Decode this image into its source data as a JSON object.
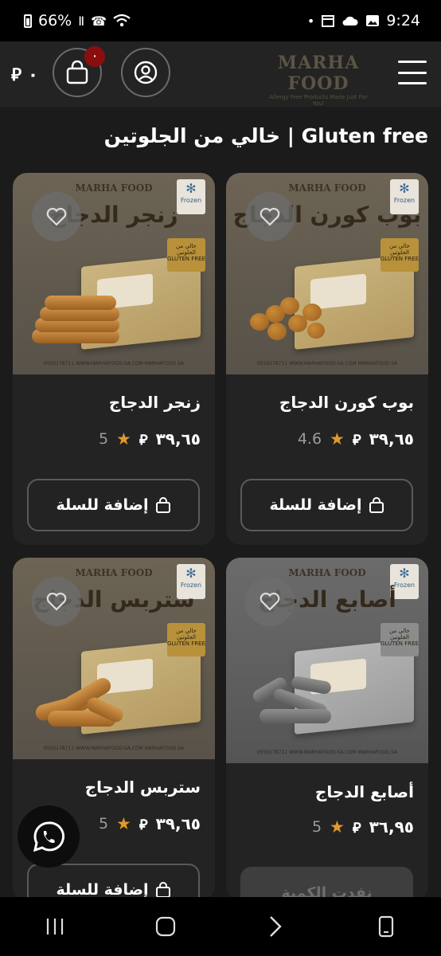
{
  "status_bar": {
    "battery": "66%",
    "time": "9:24"
  },
  "header": {
    "cart_total": "⃁ ٠",
    "cart_badge": "٠",
    "logo_text": "MARHA FOOD",
    "logo_tagline": "Allergy Free Products Made Just For You!"
  },
  "section_title": "خالي من الجلوتين | Gluten free",
  "products": [
    {
      "name": "بوب كورن الدجاج",
      "image_title": "بوب كورن الدجاج",
      "price": "٣٩,٦٥",
      "currency": "⃁",
      "rating": "4.6",
      "button": "إضافة للسلة",
      "available": true
    },
    {
      "name": "زنجر الدجاج",
      "image_title": "زنجر الدجاج",
      "price": "٣٩,٦٥",
      "currency": "⃁",
      "rating": "5",
      "button": "إضافة للسلة",
      "available": true
    },
    {
      "name": "أصابع الدجاج",
      "image_title": "أصابع الدجاج",
      "price": "٣٦,٩٥",
      "currency": "⃁",
      "rating": "5",
      "button": "نفدت الكمية",
      "available": false
    },
    {
      "name": "ستربس الدجاج",
      "image_title": "ستربس الدجاج",
      "price": "٣٩,٦٥",
      "currency": "⃁",
      "rating": "5",
      "button": "إضافة للسلة",
      "available": true
    }
  ],
  "image_labels": {
    "brand": "MARHA FOOD",
    "frozen": "Frozen",
    "gluten_tag": "خالي من الجلوتين GLUTEN FREE",
    "footer": "0550178711   WWW.MARHAFOOD-SA.COM   MARHAFOOD.SA"
  },
  "colors": {
    "background": "#1b1b1b",
    "card": "#232323",
    "accent_star": "#e19a2b",
    "badge": "#8b0e0e"
  }
}
